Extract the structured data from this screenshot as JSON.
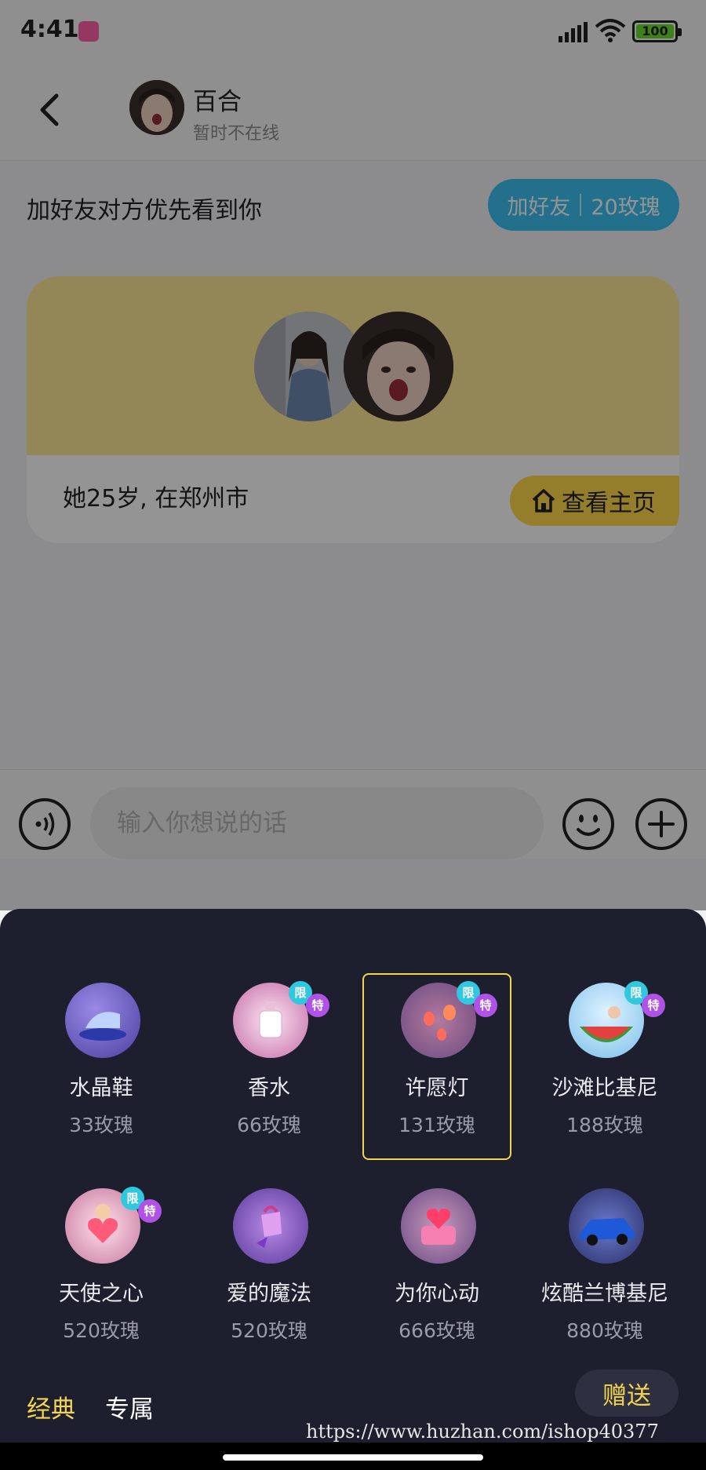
{
  "status_bar": {
    "time": "4:41",
    "battery": "100"
  },
  "header": {
    "name": "百合",
    "status": "暂时不在线"
  },
  "friend_bar": {
    "prompt": "加好友对方优先看到你",
    "button_label": "加好友",
    "button_cost": "20玫瑰"
  },
  "profile_card": {
    "info": "她25岁, 在郑州市",
    "view_home_label": "查看主页"
  },
  "input_bar": {
    "placeholder": "输入你想说的话"
  },
  "gifts": [
    {
      "name": "水晶鞋",
      "price": "33玫瑰",
      "icon": "crystal-shoe-icon",
      "limited": false,
      "special": false
    },
    {
      "name": "香水",
      "price": "66玫瑰",
      "icon": "perfume-icon",
      "limited": true,
      "special": true
    },
    {
      "name": "许愿灯",
      "price": "131玫瑰",
      "icon": "wish-lantern-icon",
      "limited": true,
      "special": true,
      "selected": true
    },
    {
      "name": "沙滩比基尼",
      "price": "188玫瑰",
      "icon": "beach-bikini-icon",
      "limited": true,
      "special": true
    },
    {
      "name": "天使之心",
      "price": "520玫瑰",
      "icon": "angel-heart-icon",
      "limited": true,
      "special": true
    },
    {
      "name": "爱的魔法",
      "price": "520玫瑰",
      "icon": "love-magic-icon",
      "limited": false,
      "special": false
    },
    {
      "name": "为你心动",
      "price": "666玫瑰",
      "icon": "heartbeat-gift-icon",
      "limited": false,
      "special": false
    },
    {
      "name": "炫酷兰博基尼",
      "price": "880玫瑰",
      "icon": "lamborghini-icon",
      "limited": false,
      "special": false
    }
  ],
  "badges": {
    "limited": "限",
    "special": "特"
  },
  "tabs": {
    "classic": "经典",
    "exclusive": "专属"
  },
  "send_label": "赠送",
  "watermark": "https://www.huzhan.com/ishop40377",
  "colors": {
    "accent": "#f2d44f",
    "friend_button": "#3dc1f2",
    "panel_bg": "#1d1e2e",
    "card_top": "#fde796"
  }
}
